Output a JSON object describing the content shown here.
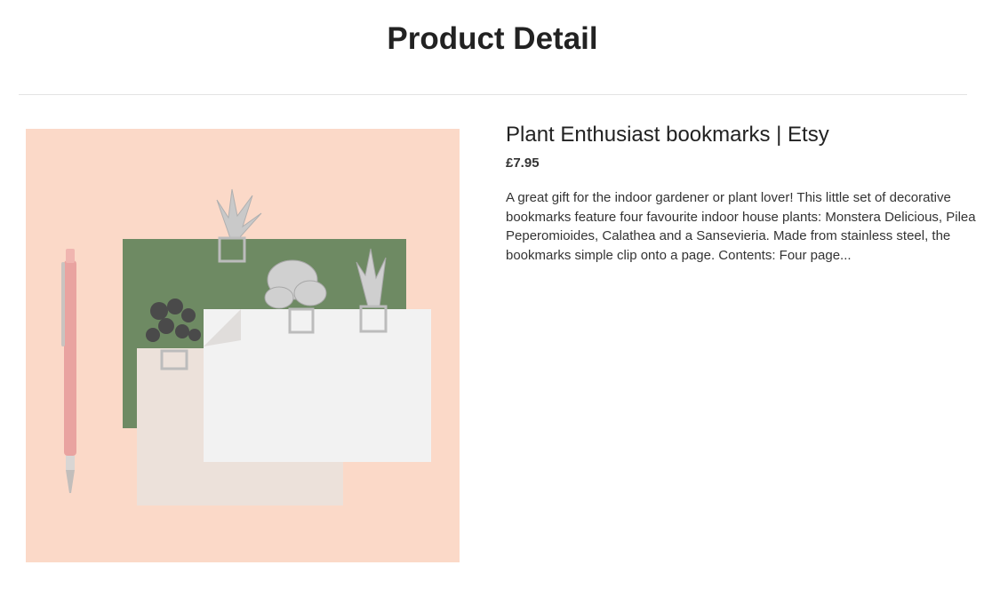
{
  "page": {
    "title": "Product Detail"
  },
  "product": {
    "title": "Plant Enthusiast bookmarks | Etsy",
    "price": "£7.95",
    "description": "A great gift for the indoor gardener or plant lover! This little set of decorative bookmarks feature four favourite indoor house plants: Monstera Delicious, Pilea Peperomioides, Calathea and a Sansevieria. Made from stainless steel, the bookmarks simple clip onto a page. Contents: Four page...",
    "image_subject": "plant bookmarks photo"
  },
  "colors": {
    "background": "#ffffff",
    "photo_background": "#fbd9c8",
    "card_green": "#6e8a63",
    "pen_pink": "#e9a3a0",
    "text": "#222222",
    "divider": "#e3e3e3"
  }
}
